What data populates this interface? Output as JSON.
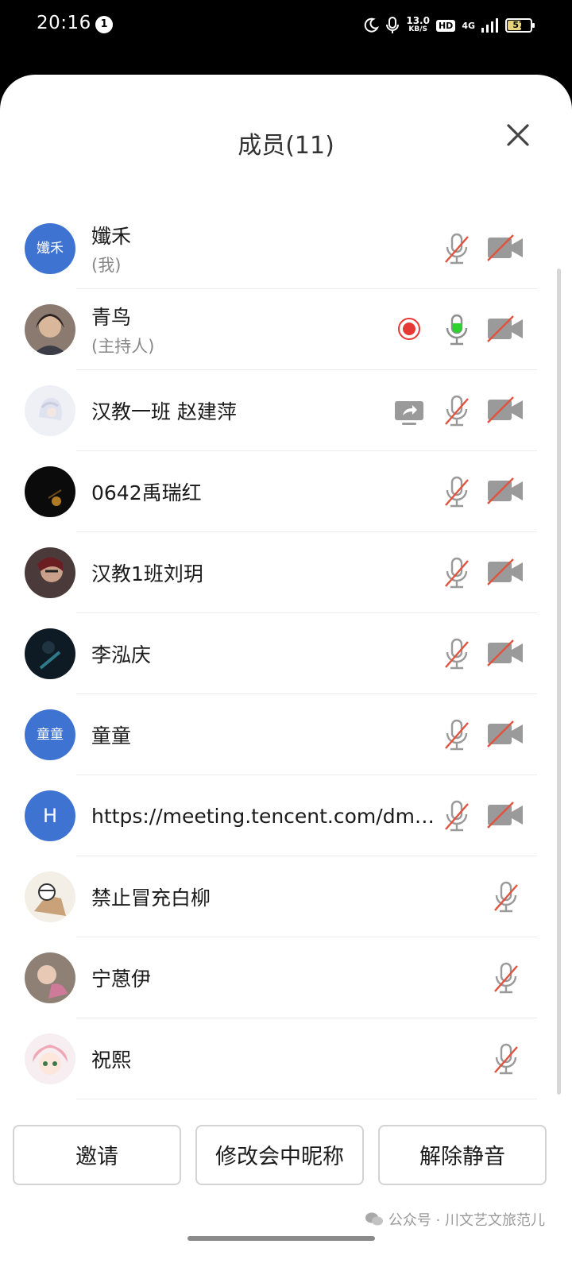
{
  "status_bar": {
    "time": "20:16",
    "notification_count": "1",
    "net_speed_value": "13.0",
    "net_speed_unit": "KB/S",
    "hd_label": "HD",
    "network_label": "4G",
    "battery_level": "57"
  },
  "panel": {
    "title": "成员(11)",
    "close_icon": "close-icon"
  },
  "members": [
    {
      "avatar_text": "孅禾",
      "avatar_color": "#3f73d1",
      "name": "孅禾",
      "subtitle": "(我)",
      "mic": "muted",
      "camera": "off"
    },
    {
      "avatar_text": "",
      "name": "青鸟",
      "subtitle": "(主持人)",
      "recording": true,
      "mic": "speaking",
      "camera": "off"
    },
    {
      "avatar_text": "",
      "name": "汉教一班 赵建萍",
      "subtitle": "",
      "sharing_screen": true,
      "mic": "muted",
      "camera": "off"
    },
    {
      "avatar_text": "",
      "name": "0642禹瑞红",
      "subtitle": "",
      "mic": "muted",
      "camera": "off"
    },
    {
      "avatar_text": "",
      "name": "汉教1班刘玥",
      "subtitle": "",
      "mic": "muted",
      "camera": "off"
    },
    {
      "avatar_text": "",
      "name": "李泓庆",
      "subtitle": "",
      "mic": "muted",
      "camera": "off"
    },
    {
      "avatar_text": "童童",
      "avatar_color": "#3f73d1",
      "name": "童童",
      "subtitle": "",
      "mic": "muted",
      "camera": "off"
    },
    {
      "avatar_text": "H",
      "avatar_color": "#3f73d1",
      "name": "https://meeting.tencent.com/dm/...",
      "subtitle": "",
      "mic": "muted",
      "camera": "off"
    },
    {
      "avatar_text": "",
      "name": "禁止冒充白柳",
      "subtitle": "",
      "mic": "muted",
      "camera": "none"
    },
    {
      "avatar_text": "",
      "name": "宁蒽伊",
      "subtitle": "",
      "mic": "muted",
      "camera": "none"
    },
    {
      "avatar_text": "",
      "name": "祝熙",
      "subtitle": "",
      "mic": "muted",
      "camera": "none"
    }
  ],
  "buttons": {
    "invite": "邀请",
    "rename": "修改会中昵称",
    "unmute": "解除静音"
  },
  "watermark": "公众号 · 川文艺文旅范儿",
  "colors": {
    "avatar_blue": "#3f73d1",
    "speaking_green": "#2fd02f",
    "record_red": "#e53935",
    "slash_red": "#e0533f",
    "icon_gray": "#9a9a9a"
  }
}
